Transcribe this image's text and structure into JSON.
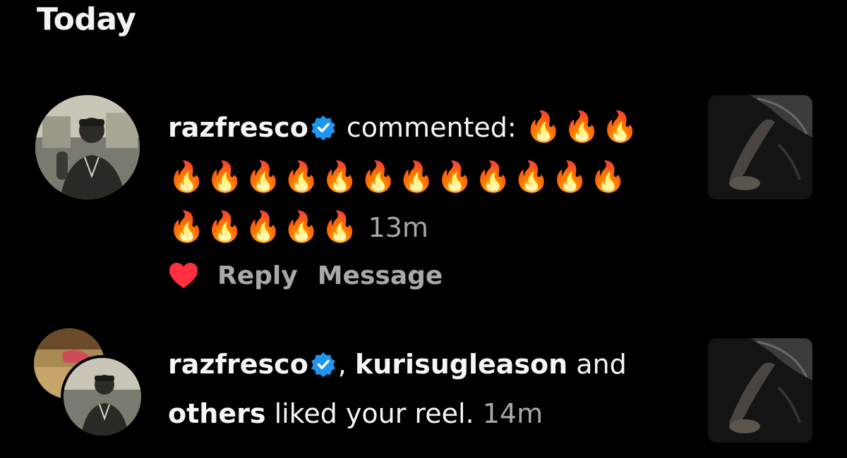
{
  "section": {
    "title": "Today"
  },
  "notifications": [
    {
      "username": "razfresco",
      "action": "commented:",
      "comment_line1": "🔥🔥🔥",
      "comment_line2": "🔥🔥🔥🔥🔥🔥🔥🔥🔥🔥🔥🔥",
      "comment_line3": "🔥🔥🔥🔥🔥",
      "time": "13m",
      "reply_label": "Reply",
      "message_label": "Message",
      "liked": true
    },
    {
      "username": "razfresco",
      "separator": ",",
      "second_username": "kurisugleason",
      "and_text": "and",
      "others_text": "others",
      "action": "liked your reel.",
      "time": "14m"
    }
  ],
  "colors": {
    "background": "#000000",
    "text": "#f5f5f5",
    "muted": "#a8a8a8",
    "verified": "#1e96f0",
    "heart": "#ff3040"
  }
}
